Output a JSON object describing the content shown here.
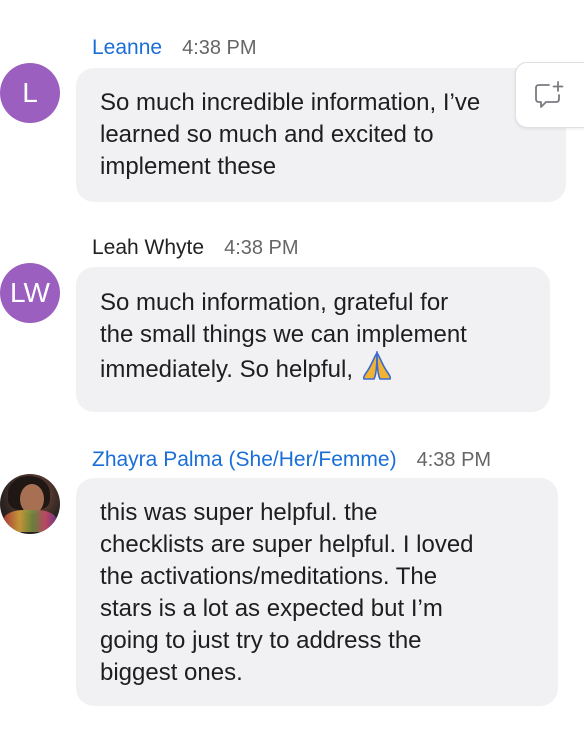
{
  "messages": [
    {
      "sender": "Leanne",
      "avatar_initials": "L",
      "time": "4:38 PM",
      "text": "So much incredible information, I’ve\nlearned so much and excited to\nimplement these"
    },
    {
      "sender": "Leah Whyte",
      "avatar_initials": "LW",
      "time": "4:38 PM",
      "text": "So much information, grateful for\nthe small things we can implement\nimmediately. So helpful,",
      "emoji": "folded-hands"
    },
    {
      "sender": "Zhayra Palma (She/Her/Femme)",
      "avatar": "photo",
      "time": "4:38 PM",
      "text": "this was super helpful. the\nchecklists are super helpful. I loved\nthe activations/meditations. The\nstars is a lot as expected but I’m\ngoing to just try to address the\nbiggest ones."
    }
  ],
  "colors": {
    "avatar_purple": "#9b5fc0",
    "link_blue": "#1a6ed8",
    "bubble_bg": "#f1f1f4"
  },
  "icons": {
    "react": "add-comment-icon",
    "emoji": "folded-hands-emoji"
  }
}
